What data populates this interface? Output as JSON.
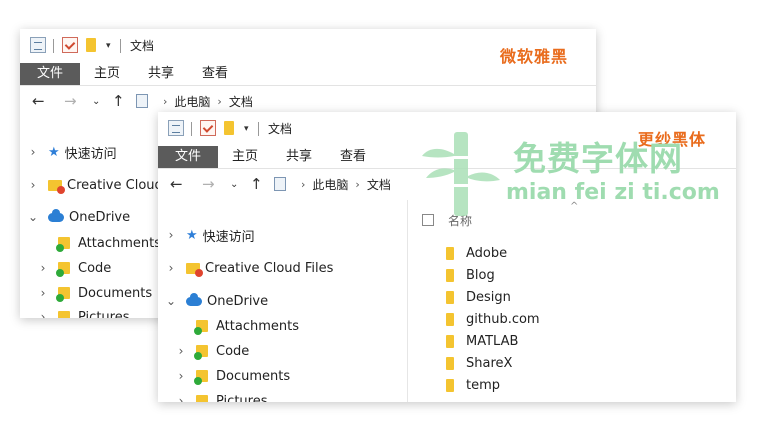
{
  "back_window": {
    "title": "文档",
    "font_label": "微软雅黑",
    "ribbon_tabs": [
      "文件",
      "主页",
      "共享",
      "查看"
    ],
    "breadcrumb": [
      "此电脑",
      "文档"
    ],
    "nav_items": [
      {
        "label": "快速访问",
        "icon": "star-icon"
      },
      {
        "label": "Creative Cloud",
        "icon": "creative-cloud-folder-icon"
      },
      {
        "label": "OneDrive",
        "icon": "onedrive-cloud-icon"
      },
      {
        "label": "Attachments",
        "icon": "onedrive-folder-icon"
      },
      {
        "label": "Code",
        "icon": "onedrive-folder-icon"
      },
      {
        "label": "Documents",
        "icon": "onedrive-folder-icon"
      },
      {
        "label": "Pictures",
        "icon": "onedrive-folder-icon"
      }
    ]
  },
  "front_window": {
    "title": "文档",
    "font_label": "更纱黑体",
    "ribbon_tabs": [
      "文件",
      "主页",
      "共享",
      "查看"
    ],
    "breadcrumb": [
      "此电脑",
      "文档"
    ],
    "nav_items": [
      {
        "label": "快速访问",
        "icon": "star-icon"
      },
      {
        "label": "Creative Cloud Files",
        "icon": "creative-cloud-folder-icon"
      },
      {
        "label": "OneDrive",
        "icon": "onedrive-cloud-icon"
      },
      {
        "label": "Attachments",
        "icon": "onedrive-folder-icon"
      },
      {
        "label": "Code",
        "icon": "onedrive-folder-icon"
      },
      {
        "label": "Documents",
        "icon": "onedrive-folder-icon"
      },
      {
        "label": "Pictures",
        "icon": "onedrive-folder-icon"
      }
    ],
    "column_header": "名称",
    "files": [
      "Adobe",
      "Blog",
      "Design",
      "github.com",
      "MATLAB",
      "ShareX",
      "temp"
    ]
  },
  "watermark": {
    "title": "免费字体网",
    "subtitle": "mian fei zi ti.com",
    "color": "#9fdcb0"
  },
  "colors": {
    "accent_orange": "#e96c1d",
    "file_tab_bg": "#5b5b5b",
    "folder_yellow": "#f4c430",
    "onedrive_blue": "#2b7fd4",
    "sync_green": "#2eaa3a"
  }
}
